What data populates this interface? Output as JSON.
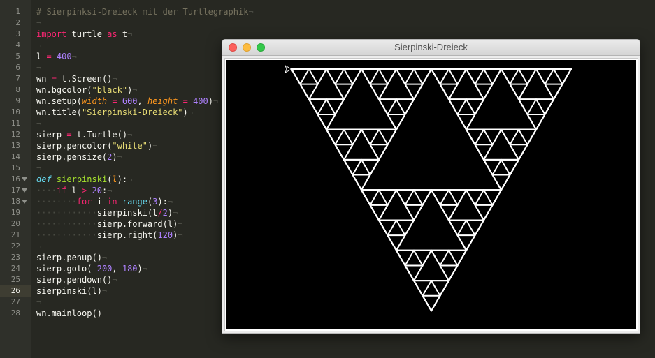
{
  "editor": {
    "current_line": 26,
    "lines": [
      {
        "n": "1",
        "tokens": [
          [
            "cm",
            "# Sierpinksi-Dreieck mit der Turtlegraphik"
          ],
          [
            "ws",
            "¬"
          ]
        ]
      },
      {
        "n": "2",
        "tokens": [
          [
            "ws",
            "¬"
          ]
        ]
      },
      {
        "n": "3",
        "tokens": [
          [
            "kw",
            "import"
          ],
          [
            "",
            " turtle "
          ],
          [
            "kw",
            "as"
          ],
          [
            "",
            " t"
          ],
          [
            "ws",
            "¬"
          ]
        ]
      },
      {
        "n": "4",
        "tokens": [
          [
            "ws",
            "¬"
          ]
        ]
      },
      {
        "n": "5",
        "tokens": [
          [
            "",
            "l "
          ],
          [
            "op",
            "="
          ],
          [
            "",
            " "
          ],
          [
            "num",
            "400"
          ],
          [
            "ws",
            "¬"
          ]
        ]
      },
      {
        "n": "6",
        "tokens": [
          [
            "ws",
            "¬"
          ]
        ]
      },
      {
        "n": "7",
        "tokens": [
          [
            "",
            "wn "
          ],
          [
            "op",
            "="
          ],
          [
            "",
            " t.Screen()"
          ],
          [
            "ws",
            "¬"
          ]
        ]
      },
      {
        "n": "8",
        "tokens": [
          [
            "",
            "wn.bgcolor("
          ],
          [
            "str",
            "\"black\""
          ],
          [
            "",
            ")"
          ],
          [
            "ws",
            "¬"
          ]
        ]
      },
      {
        "n": "9",
        "tokens": [
          [
            "",
            "wn.setup("
          ],
          [
            "param",
            "width"
          ],
          [
            "",
            " "
          ],
          [
            "op",
            "="
          ],
          [
            "",
            " "
          ],
          [
            "num",
            "600"
          ],
          [
            "",
            ", "
          ],
          [
            "param",
            "height"
          ],
          [
            "",
            " "
          ],
          [
            "op",
            "="
          ],
          [
            "",
            " "
          ],
          [
            "num",
            "400"
          ],
          [
            "",
            ")"
          ],
          [
            "ws",
            "¬"
          ]
        ]
      },
      {
        "n": "10",
        "tokens": [
          [
            "",
            "wn.title("
          ],
          [
            "str",
            "\"Sierpinski-Dreieck\""
          ],
          [
            "",
            ")"
          ],
          [
            "ws",
            "¬"
          ]
        ]
      },
      {
        "n": "11",
        "tokens": [
          [
            "ws",
            "¬"
          ]
        ]
      },
      {
        "n": "12",
        "tokens": [
          [
            "",
            "sierp "
          ],
          [
            "op",
            "="
          ],
          [
            "",
            " t.Turtle()"
          ],
          [
            "ws",
            "¬"
          ]
        ]
      },
      {
        "n": "13",
        "tokens": [
          [
            "",
            "sierp.pencolor("
          ],
          [
            "str",
            "\"white\""
          ],
          [
            "",
            ")"
          ],
          [
            "ws",
            "¬"
          ]
        ]
      },
      {
        "n": "14",
        "tokens": [
          [
            "",
            "sierp.pensize("
          ],
          [
            "num",
            "2"
          ],
          [
            "",
            ")"
          ],
          [
            "ws",
            "¬"
          ]
        ]
      },
      {
        "n": "15",
        "tokens": [
          [
            "ws",
            "¬"
          ]
        ]
      },
      {
        "n": "16",
        "fold": true,
        "tokens": [
          [
            "def",
            "def"
          ],
          [
            "",
            " "
          ],
          [
            "fn",
            "sierpinski"
          ],
          [
            "",
            "("
          ],
          [
            "param",
            "l"
          ],
          [
            "",
            "):"
          ],
          [
            "ws",
            "¬"
          ]
        ]
      },
      {
        "n": "17",
        "fold": true,
        "tokens": [
          [
            "ws",
            "····"
          ],
          [
            "kw",
            "if"
          ],
          [
            "",
            " l "
          ],
          [
            "op",
            ">"
          ],
          [
            "",
            " "
          ],
          [
            "num",
            "20"
          ],
          [
            "",
            ":"
          ],
          [
            "ws",
            "¬"
          ]
        ]
      },
      {
        "n": "18",
        "fold": true,
        "tokens": [
          [
            "ws",
            "········"
          ],
          [
            "kw",
            "for"
          ],
          [
            "",
            " i "
          ],
          [
            "kw",
            "in"
          ],
          [
            "",
            " "
          ],
          [
            "bi",
            "range"
          ],
          [
            "",
            "("
          ],
          [
            "num",
            "3"
          ],
          [
            "",
            "):"
          ],
          [
            "ws",
            "¬"
          ]
        ]
      },
      {
        "n": "19",
        "tokens": [
          [
            "ws",
            "············"
          ],
          [
            "",
            "sierpinski(l"
          ],
          [
            "op",
            "/"
          ],
          [
            "num",
            "2"
          ],
          [
            "",
            ")"
          ],
          [
            "ws",
            "¬"
          ]
        ]
      },
      {
        "n": "20",
        "tokens": [
          [
            "ws",
            "············"
          ],
          [
            "",
            "sierp.forward(l)"
          ],
          [
            "ws",
            "¬"
          ]
        ]
      },
      {
        "n": "21",
        "tokens": [
          [
            "ws",
            "············"
          ],
          [
            "",
            "sierp.right("
          ],
          [
            "num",
            "120"
          ],
          [
            "",
            ")"
          ],
          [
            "ws",
            "¬"
          ]
        ]
      },
      {
        "n": "22",
        "tokens": [
          [
            "ws",
            "¬"
          ]
        ]
      },
      {
        "n": "23",
        "tokens": [
          [
            "",
            "sierp.penup()"
          ],
          [
            "ws",
            "¬"
          ]
        ]
      },
      {
        "n": "24",
        "tokens": [
          [
            "",
            "sierp.goto("
          ],
          [
            "op",
            "-"
          ],
          [
            "num",
            "200"
          ],
          [
            "",
            ", "
          ],
          [
            "num",
            "180"
          ],
          [
            "",
            ")"
          ],
          [
            "ws",
            "¬"
          ]
        ]
      },
      {
        "n": "25",
        "tokens": [
          [
            "",
            "sierp.pendown()"
          ],
          [
            "ws",
            "¬"
          ]
        ]
      },
      {
        "n": "26",
        "tokens": [
          [
            "",
            "sierpinski(l)"
          ],
          [
            "ws",
            "¬"
          ]
        ]
      },
      {
        "n": "27",
        "tokens": [
          [
            "ws",
            "¬"
          ]
        ]
      },
      {
        "n": "28",
        "tokens": [
          [
            "",
            "wn.mainloop()"
          ]
        ]
      }
    ]
  },
  "window": {
    "title": "Sierpinski-Dreieck",
    "close_label": "",
    "minimize_label": "",
    "maximize_label": ""
  },
  "turtle": {
    "background": "#000000",
    "pen_color": "#ffffff",
    "pen_size": 2,
    "initial_length": 400,
    "min_length": 20,
    "turn_angle": 120
  },
  "colors": {
    "editor_bg": "#272822",
    "gutter_bg": "#2f302a",
    "keyword": "#f92672",
    "string": "#e6db74",
    "number": "#ae81ff",
    "comment": "#75715e",
    "function": "#a6e22e",
    "builtin": "#66d9ef",
    "parameter": "#fd971f"
  }
}
